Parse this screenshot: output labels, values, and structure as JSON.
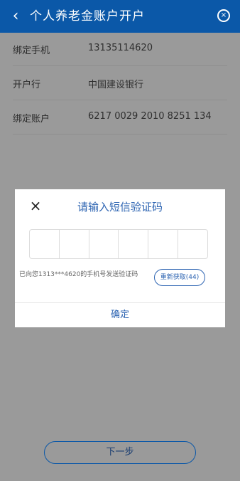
{
  "header": {
    "back_glyph": "‹",
    "title": "个人养老金账户开户",
    "close_glyph": "×"
  },
  "info_rows": [
    {
      "label": "绑定手机",
      "value": "13135114620"
    },
    {
      "label": "开户行",
      "value": "中国建设银行"
    },
    {
      "label": "绑定账户",
      "value": "6217 0029 2010 8251 134"
    }
  ],
  "modal": {
    "close_glyph": "×",
    "title": "请输入短信验证码",
    "hint": "已向您1313***4620的手机号发送验证码",
    "resend_label": "重新获取(44)",
    "confirm_label": "确定"
  },
  "footer": {
    "next_label": "下一步"
  },
  "colors": {
    "header_bg": "#0b58a8",
    "accent": "#2d64b2",
    "overlay_bg": "#9a9a9a"
  },
  "icons": {
    "back": "chevron-left-icon",
    "close": "close-circle-icon",
    "modal_close": "close-icon"
  }
}
